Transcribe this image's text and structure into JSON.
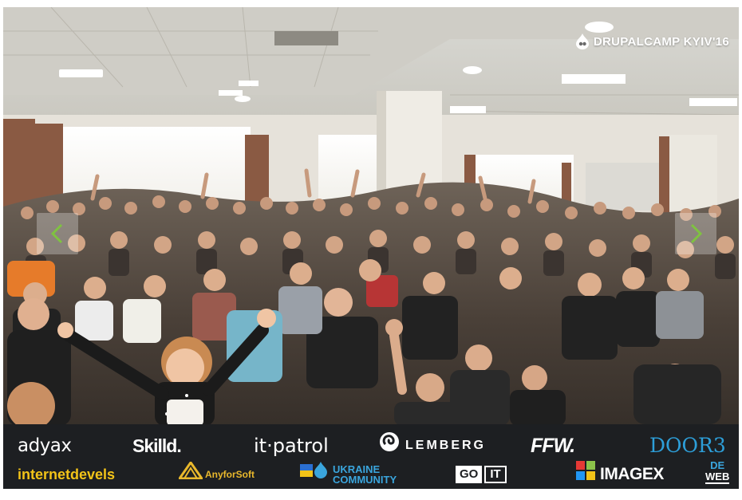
{
  "event_watermark": {
    "text": "DRUPALCAMP KYIV'16",
    "icon": "drupal-drop-icon"
  },
  "navigation": {
    "prev": {
      "icon": "chevron-left-icon",
      "color": "#7fc241"
    },
    "next": {
      "icon": "chevron-right-icon",
      "color": "#7fc241"
    }
  },
  "sponsors": {
    "row1": [
      {
        "name": "adyax",
        "text": "adyax"
      },
      {
        "name": "skilld",
        "text": "Skilld."
      },
      {
        "name": "itpatrol",
        "text": "it·patrol"
      },
      {
        "name": "lemberg",
        "text": "LEMBERG"
      },
      {
        "name": "ffw",
        "text": "FFW."
      },
      {
        "name": "door3",
        "text": "DOOR3"
      }
    ],
    "row2": [
      {
        "name": "internetdevels",
        "text": "internetdevels"
      },
      {
        "name": "anyforsoft",
        "text": "AnyforSoft"
      },
      {
        "name": "ukraine-community",
        "text_line1": "UKRAINE",
        "text_line2": "COMMUNITY"
      },
      {
        "name": "goit",
        "text_a": "GO",
        "text_b": "IT"
      },
      {
        "name": "imagex",
        "text": "IMAGEX"
      },
      {
        "name": "deweb",
        "text_line1": "DE",
        "text_line2": "WEB"
      }
    ]
  },
  "colors": {
    "sponsor_bar": "#1d1f22",
    "adyax_accent": "#4ea5e8",
    "internetdevels": "#f2c318",
    "anyforsoft": "#e9b82c",
    "ukraine_community": "#3aa5dd",
    "imagex_x": "#8bc34a",
    "door3": "#2d9ed8"
  }
}
